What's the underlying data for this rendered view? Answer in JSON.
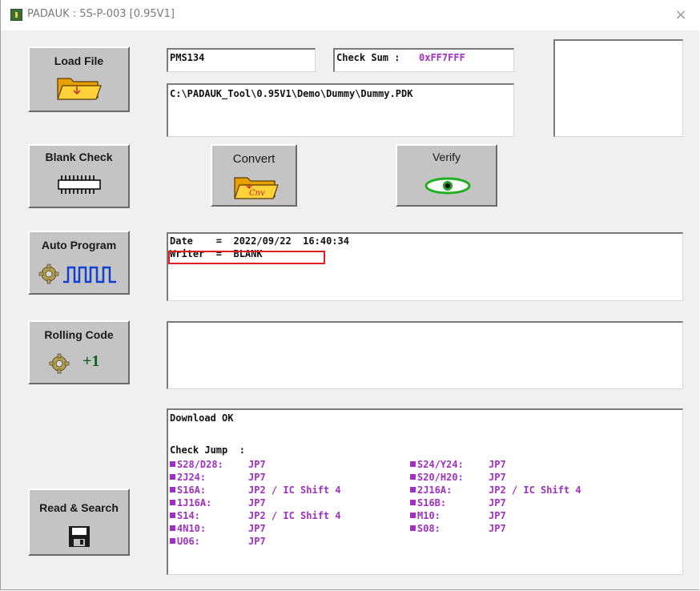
{
  "window": {
    "title": "PADAUK : 5S-P-003 [0.95V1]",
    "close_symbol": "×"
  },
  "buttons": {
    "load_file": "Load File",
    "blank_check": "Blank Check",
    "convert": "Convert",
    "verify": "Verify",
    "auto_program": "Auto Program",
    "rolling_code": "Rolling Code",
    "rolling_code_increment": "+1",
    "read_search": "Read & Search"
  },
  "icons": {
    "load_file": "folder-open-icon",
    "blank_check": "chip-icon",
    "convert": "folder-convert-icon",
    "convert_text": "Cnv",
    "verify": "eye-icon",
    "auto_program": "gear-pulse-icon",
    "rolling_code": "gear-icon",
    "read_search": "floppy-disk-icon"
  },
  "fields": {
    "ic_name": "PMS134",
    "checksum_label": "Check Sum : ",
    "checksum_value": "0xFF7FFF",
    "file_path": "C:\\PADAUK_Tool\\0.95V1\\Demo\\Dummy\\Dummy.PDK"
  },
  "info": {
    "date_line": "Date    =  2022/09/22  16:40:34",
    "writer_line": "Writer  =  BLANK"
  },
  "log": {
    "download_status": "Download OK",
    "check_jump_label": "Check Jump  :",
    "jumps_left": [
      {
        "pkg": "S28/D28:",
        "val": "JP7"
      },
      {
        "pkg": "2J24:",
        "val": "JP7"
      },
      {
        "pkg": "S16A:",
        "val": "JP2 / IC Shift 4"
      },
      {
        "pkg": "1J16A:",
        "val": "JP7"
      },
      {
        "pkg": "S14:",
        "val": "JP2 / IC Shift 4"
      },
      {
        "pkg": "4N10:",
        "val": "JP7"
      },
      {
        "pkg": "U06:",
        "val": "JP7"
      }
    ],
    "jumps_right": [
      {
        "pkg": "S24/Y24:",
        "val": "JP7"
      },
      {
        "pkg": "S20/H20:",
        "val": "JP7"
      },
      {
        "pkg": "2J16A:",
        "val": "JP2 / IC Shift 4"
      },
      {
        "pkg": "S16B:",
        "val": "JP7"
      },
      {
        "pkg": "M10:",
        "val": "JP7"
      },
      {
        "pkg": "S08:",
        "val": "JP7"
      }
    ]
  },
  "colors": {
    "highlight_box": "#e02020",
    "jump_text": "#a030c0",
    "button_face": "#c4c4c4"
  }
}
